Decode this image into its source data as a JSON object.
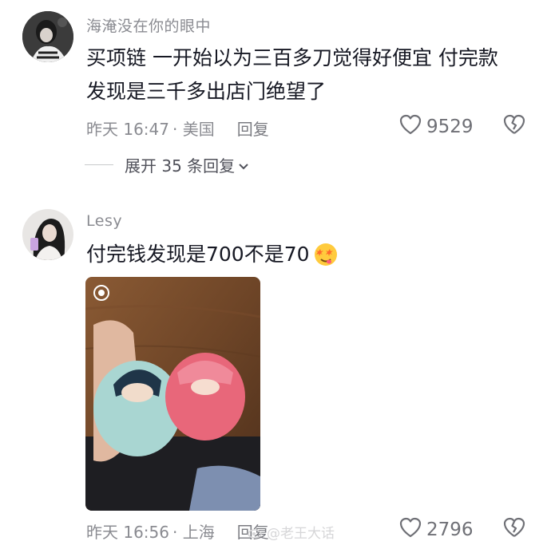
{
  "comments": [
    {
      "username": "海淹没在你的眼中",
      "text_line1": "买项链 一开始以为三百多刀觉得好便宜 付完款",
      "text_line2": "发现是三千多出店门绝望了",
      "time": "昨天 16:47",
      "location": "· 美国",
      "reply_label": "回复",
      "likes": "9529",
      "expand_label": "展开 35 条回复"
    },
    {
      "username": "Lesy",
      "text": "付完钱发现是700不是70",
      "emoji": "dizzy-face-emoji",
      "time": "昨天 16:56",
      "location": "· 上海",
      "reply_label": "回复",
      "likes": "2796"
    }
  ],
  "watermark": {
    "text": "@老王大话",
    "icon": "weibo-logo-icon"
  },
  "colors": {
    "primary_text": "#161823",
    "secondary_text": "#8a8b91",
    "background": "#ffffff"
  }
}
